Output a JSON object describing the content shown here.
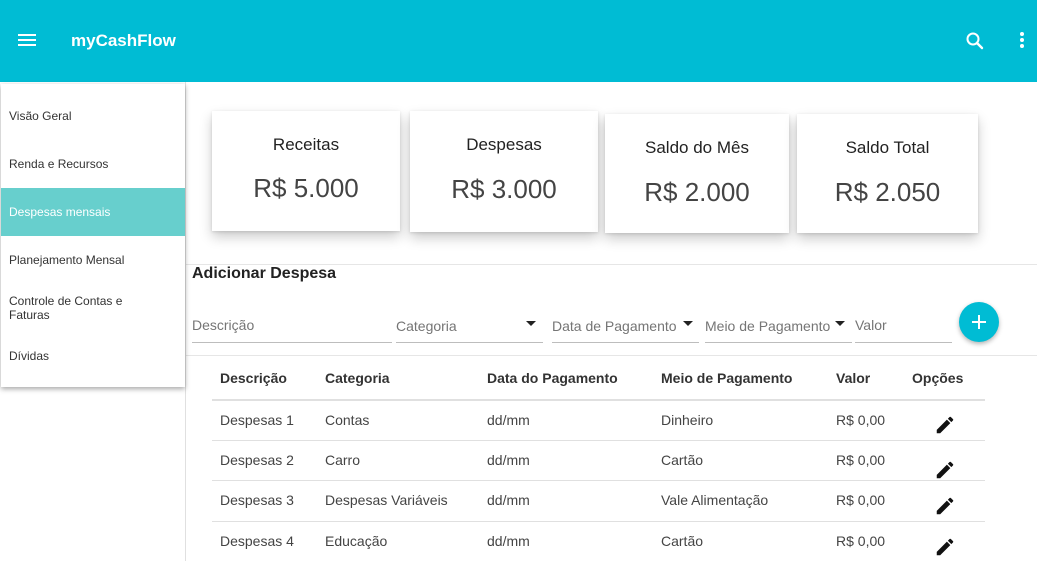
{
  "app": {
    "title": "myCashFlow"
  },
  "sidebar": {
    "items": [
      {
        "label": "Visão Geral"
      },
      {
        "label": "Renda e Recursos"
      },
      {
        "label": "Despesas mensais"
      },
      {
        "label": "Planejamento Mensal"
      },
      {
        "label": "Controle de Contas e Faturas"
      },
      {
        "label": "Dívidas"
      }
    ],
    "active_index": 2
  },
  "summary": {
    "cards": [
      {
        "label": "Receitas",
        "value": "R$ 5.000"
      },
      {
        "label": "Despesas",
        "value": "R$ 3.000"
      },
      {
        "label": "Saldo do Mês",
        "value": "R$ 2.000"
      },
      {
        "label": "Saldo Total",
        "value": "R$ 2.050"
      }
    ]
  },
  "form": {
    "title": "Adicionar Despesa",
    "description_placeholder": "Descrição",
    "category_label": "Categoria",
    "payment_date_label": "Data de Pagamento",
    "payment_method_label": "Meio de Pagamento",
    "value_placeholder": "Valor"
  },
  "table": {
    "headers": [
      "Descrição",
      "Categoria",
      "Data do Pagamento",
      "Meio de Pagamento",
      "Valor",
      "Opções"
    ],
    "rows": [
      [
        "Despesas 1",
        "Contas",
        "dd/mm",
        "Dinheiro",
        "R$ 0,00"
      ],
      [
        "Despesas 2",
        "Carro",
        "dd/mm",
        "Cartão",
        "R$ 0,00"
      ],
      [
        "Despesas 3",
        "Despesas Variáveis",
        "dd/mm",
        "Vale Alimentação",
        "R$ 0,00"
      ],
      [
        "Despesas 4",
        "Educação",
        "dd/mm",
        "Cartão",
        "R$ 0,00"
      ]
    ]
  },
  "colors": {
    "primary": "#00bcd4",
    "active_nav": "#67cfcd"
  },
  "icons": {
    "menu": "menu-icon",
    "search": "search-icon",
    "more": "more-vert-icon",
    "add": "plus-icon",
    "edit": "pencil-icon"
  }
}
